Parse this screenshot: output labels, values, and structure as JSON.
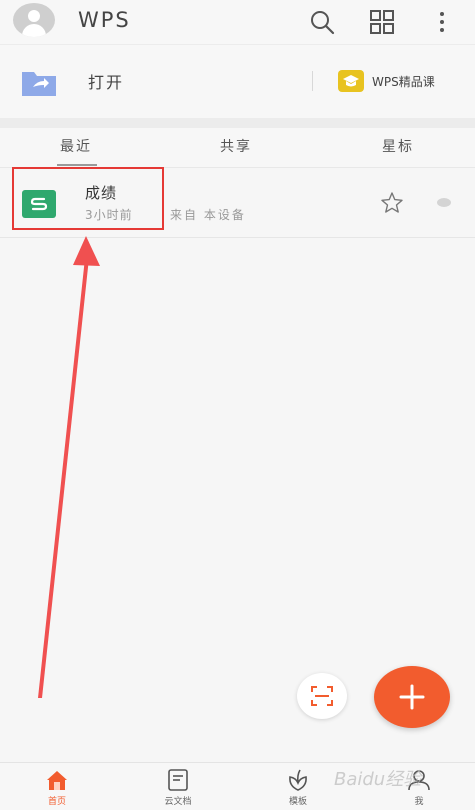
{
  "header": {
    "logo_text": "WPS",
    "avatar_icon": "user-avatar-icon",
    "search_icon": "search-icon",
    "grid_icon": "grid-icon",
    "more_icon": "more-vertical-icon"
  },
  "open_row": {
    "label": "打开",
    "course_label": "WPS精品课",
    "folder_color": "#8ea9e8",
    "course_color": "#e8c320"
  },
  "tabs": [
    {
      "label": "最近",
      "active": true
    },
    {
      "label": "共享",
      "active": false
    },
    {
      "label": "星标",
      "active": false
    }
  ],
  "files": [
    {
      "name": "成绩",
      "time": "3小时前",
      "source": "来自 本设备",
      "icon_letter": "S",
      "icon_color": "#2fa86e"
    }
  ],
  "bottom_nav": [
    {
      "label": "首页",
      "icon": "home-icon",
      "active": true
    },
    {
      "label": "云文档",
      "icon": "document-icon",
      "active": false
    },
    {
      "label": "模板",
      "icon": "leaf-icon",
      "active": false
    },
    {
      "label": "我",
      "icon": "person-icon",
      "active": false
    }
  ],
  "watermark": "Baidu经验",
  "accent_color": "#f25c2e",
  "annotation_color": "#e53935"
}
